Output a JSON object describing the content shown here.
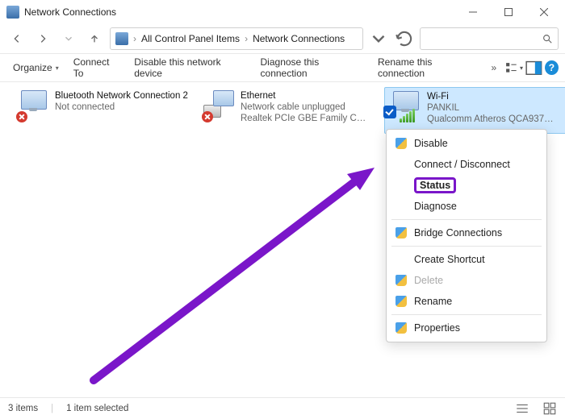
{
  "window": {
    "title": "Network Connections"
  },
  "breadcrumb": {
    "item1": "All Control Panel Items",
    "item2": "Network Connections"
  },
  "search": {
    "placeholder": ""
  },
  "toolbar": {
    "organize": "Organize",
    "connect_to": "Connect To",
    "disable": "Disable this network device",
    "diagnose": "Diagnose this connection",
    "rename": "Rename this connection"
  },
  "connections": [
    {
      "name": "Bluetooth Network Connection 2",
      "status": "Not connected",
      "device": ""
    },
    {
      "name": "Ethernet",
      "status": "Network cable unplugged",
      "device": "Realtek PCIe GBE Family Contr..."
    },
    {
      "name": "Wi-Fi",
      "status": "PANKIL",
      "device": "Qualcomm Atheros QCA9377 ..."
    }
  ],
  "context_menu": {
    "disable": "Disable",
    "connect_disconnect": "Connect / Disconnect",
    "status": "Status",
    "diagnose": "Diagnose",
    "bridge": "Bridge Connections",
    "create_shortcut": "Create Shortcut",
    "delete": "Delete",
    "rename": "Rename",
    "properties": "Properties"
  },
  "statusbar": {
    "count": "3 items",
    "selected": "1 item selected"
  }
}
